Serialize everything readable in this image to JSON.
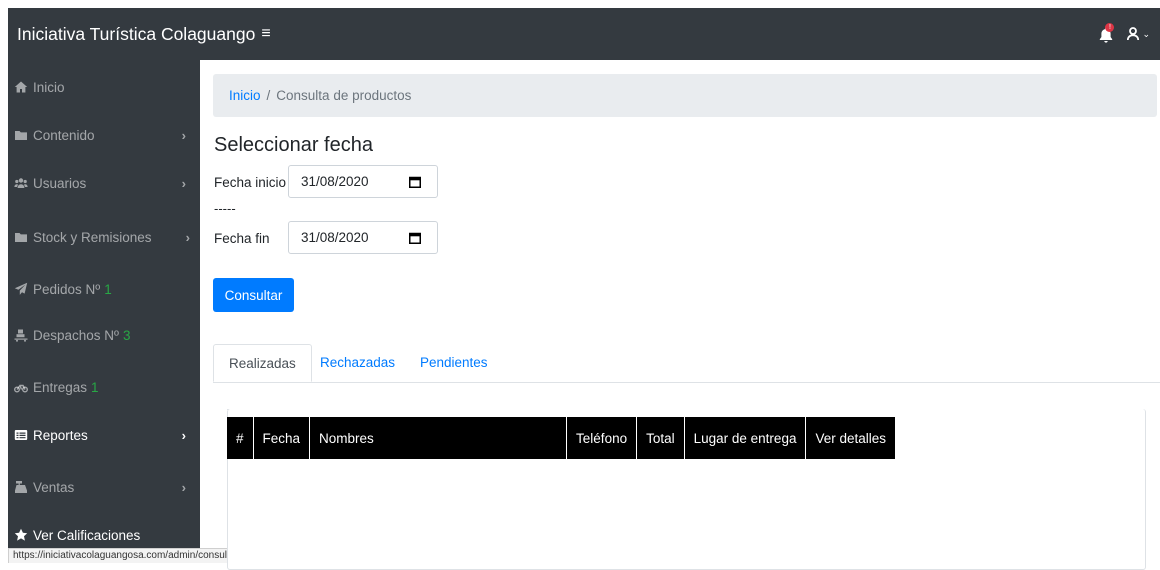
{
  "header": {
    "brand": "Iniciativa Turística Colaguango",
    "menu_icon": "hamburger-icon",
    "notification_count": "!",
    "bell_icon": "bell-icon",
    "user_icon": "user-icon"
  },
  "sidebar": {
    "items": [
      {
        "label": "Inicio",
        "icon": "home-icon",
        "count": "",
        "has_chevron": false
      },
      {
        "label": "Contenido",
        "icon": "folder-icon",
        "count": "",
        "has_chevron": true
      },
      {
        "label": "Usuarios",
        "icon": "users-icon",
        "count": "",
        "has_chevron": true
      },
      {
        "label": "Stock y Remisiones",
        "icon": "folder-icon",
        "count": "",
        "has_chevron": true
      },
      {
        "label": "Pedidos Nº",
        "icon": "paper-plane-icon",
        "count": "1",
        "has_chevron": false
      },
      {
        "label": "Despachos Nº",
        "icon": "dolly-icon",
        "count": "3",
        "has_chevron": false
      },
      {
        "label": "Entregas",
        "icon": "motorcycle-icon",
        "count": "1",
        "has_chevron": false
      },
      {
        "label": "Reportes",
        "icon": "report-icon",
        "count": "",
        "has_chevron": true
      },
      {
        "label": "Ventas",
        "icon": "cash-register-icon",
        "count": "",
        "has_chevron": true
      },
      {
        "label": "Ver Calificaciones",
        "icon": "star-icon",
        "count": "",
        "has_chevron": false
      }
    ],
    "chevron": "›",
    "active_index": 7
  },
  "status_url": "https://iniciativacolaguangosa.com/admin/consulta/",
  "breadcrumb": {
    "home": "Inicio",
    "separator": "/",
    "current": "Consulta de productos"
  },
  "page_title": "Seleccionar fecha",
  "form": {
    "start_label": "Fecha inicio",
    "start_value": "31/08/2020",
    "separator": "-----",
    "end_label": "Fecha fin",
    "end_value": "31/08/2020",
    "submit_label": "Consultar"
  },
  "tabs": [
    {
      "label": "Realizadas",
      "active": true
    },
    {
      "label": "Rechazadas",
      "active": false
    },
    {
      "label": "Pendientes",
      "active": false
    }
  ],
  "table": {
    "columns": [
      "#",
      "Fecha",
      "Nombres",
      "Teléfono",
      "Total",
      "Lugar de entrega",
      "Ver detalles"
    ],
    "rows": []
  },
  "colors": {
    "sidebar_bg": "#343a40",
    "primary": "#007bff",
    "count_green": "#28a745",
    "badge_red": "#dc3545"
  }
}
